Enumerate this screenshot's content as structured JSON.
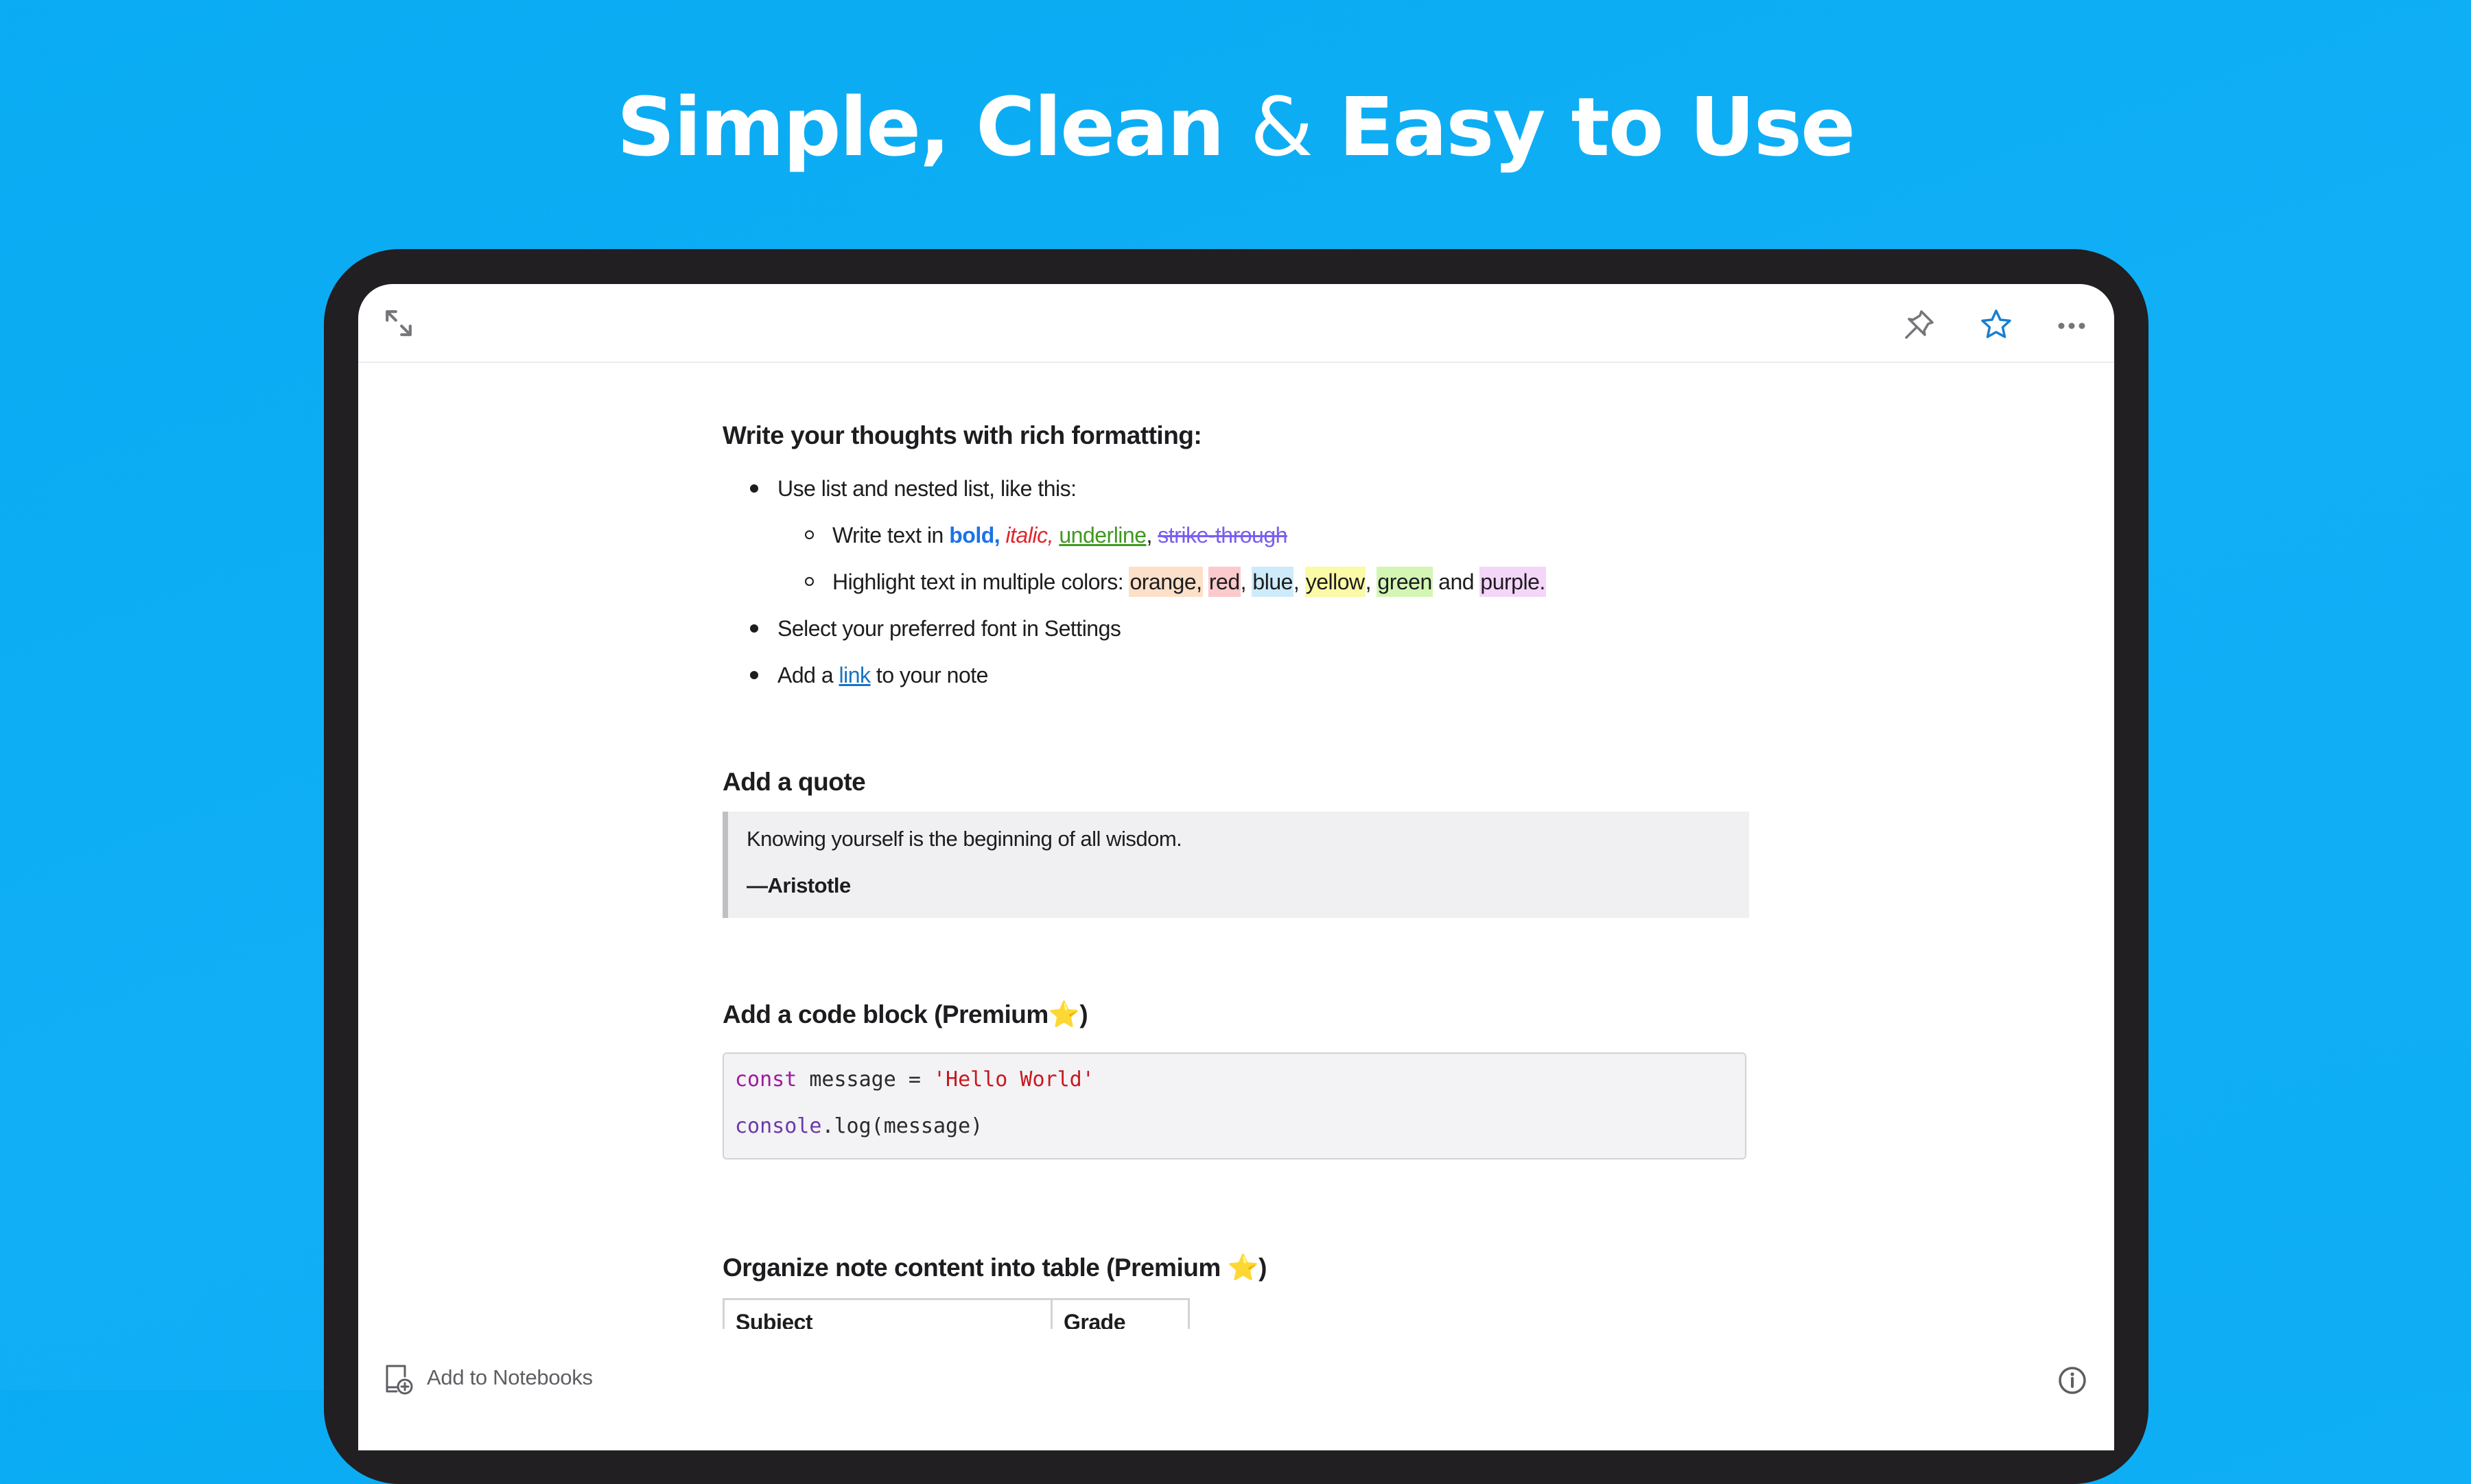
{
  "hero": {
    "title_part1": "Simple, Clean ",
    "title_amp": "&",
    "title_part2": " Easy to Use"
  },
  "toolbar": {
    "icons": [
      "expand-icon",
      "pin-icon",
      "star-icon",
      "more-icon"
    ],
    "star_color": "#1a7fd0"
  },
  "note": {
    "section1": {
      "heading": "Write your thoughts with rich formatting:",
      "items": [
        {
          "text": "Use list and nested list, like this:"
        },
        {
          "nested": true,
          "prefix": "Write text in ",
          "bold": "bold,",
          "italic": "italic,",
          "underline": "underline",
          "comma": ", ",
          "strike": "strike-through"
        },
        {
          "nested": true,
          "prefix": "Highlight text in multiple colors: ",
          "orange": "orange,",
          "red": "red",
          "blue": "blue",
          "yellow": "yellow",
          "green": "green",
          "and": " and ",
          "purple": "purple.",
          "sep": ", "
        },
        {
          "text": "Select your preferred font in Settings"
        },
        {
          "prefix": "Add a ",
          "link": "link",
          "suffix": " to your note"
        }
      ]
    },
    "section2": {
      "heading": "Add a quote",
      "quote": "Knowing yourself is the beginning of all wisdom.",
      "author": "—Aristotle"
    },
    "section3": {
      "heading": "Add a code block (Premium",
      "heading_star": "⭐",
      "heading_close": ")",
      "code": [
        {
          "kw": "const",
          "rest": " message = ",
          "str": "'Hello World'"
        },
        {
          "obj": "console",
          "rest": ".log(message)"
        }
      ]
    },
    "section4": {
      "heading": "Organize note content into table (Premium ",
      "heading_star": "⭐",
      "heading_close": ")",
      "table_headers": [
        "Subject",
        "Grade"
      ]
    }
  },
  "bottombar": {
    "add_to_notebooks": "Add to Notebooks"
  },
  "colors": {
    "background": "#0eaef5",
    "device_frame": "#211f21",
    "bold": "#1a73e8",
    "italic": "#e0262b",
    "underline": "#3f9a1f",
    "strike": "#7a5ef0",
    "link": "#1773c4",
    "highlight_orange": "#fde0c9",
    "highlight_red": "#fcc9cc",
    "highlight_blue": "#cdebfa",
    "highlight_yellow": "#fbfaa6",
    "highlight_green": "#d3f6b4",
    "highlight_purple": "#f4d6f8"
  }
}
